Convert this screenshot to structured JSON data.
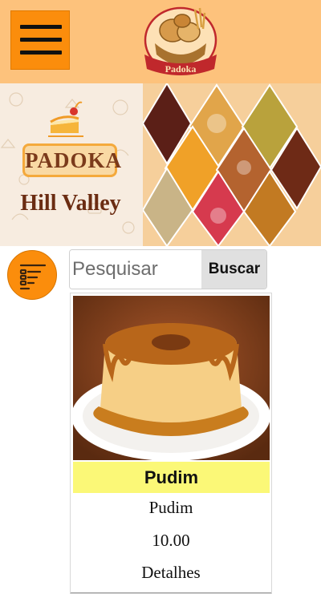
{
  "header": {
    "menu_icon": "hamburger-menu-icon",
    "logo_text": "Padoka",
    "background": "#fdc27c",
    "menu_color": "#fb8d0c"
  },
  "banner": {
    "brand_title": "PADOKA",
    "brand_subtitle": "Hill Valley"
  },
  "filter": {
    "icon": "filter-list-icon",
    "color": "#fb8d0c"
  },
  "search": {
    "placeholder": "Pesquisar",
    "value": "",
    "button_label": "Buscar"
  },
  "products": [
    {
      "name": "Pudim",
      "description": "Pudim",
      "price": "10.00",
      "details_label": "Detalhes",
      "name_bg": "#fbf877"
    }
  ]
}
